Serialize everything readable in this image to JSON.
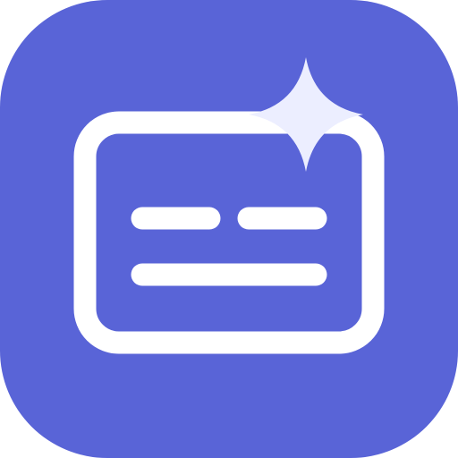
{
  "icon": {
    "name": "caption-sparkle-app-icon",
    "colors": {
      "tile": "#5964D7",
      "frame": "#FFFFFF",
      "lines": "#FFFFFF",
      "sparkle": "#ECEEFF"
    }
  }
}
